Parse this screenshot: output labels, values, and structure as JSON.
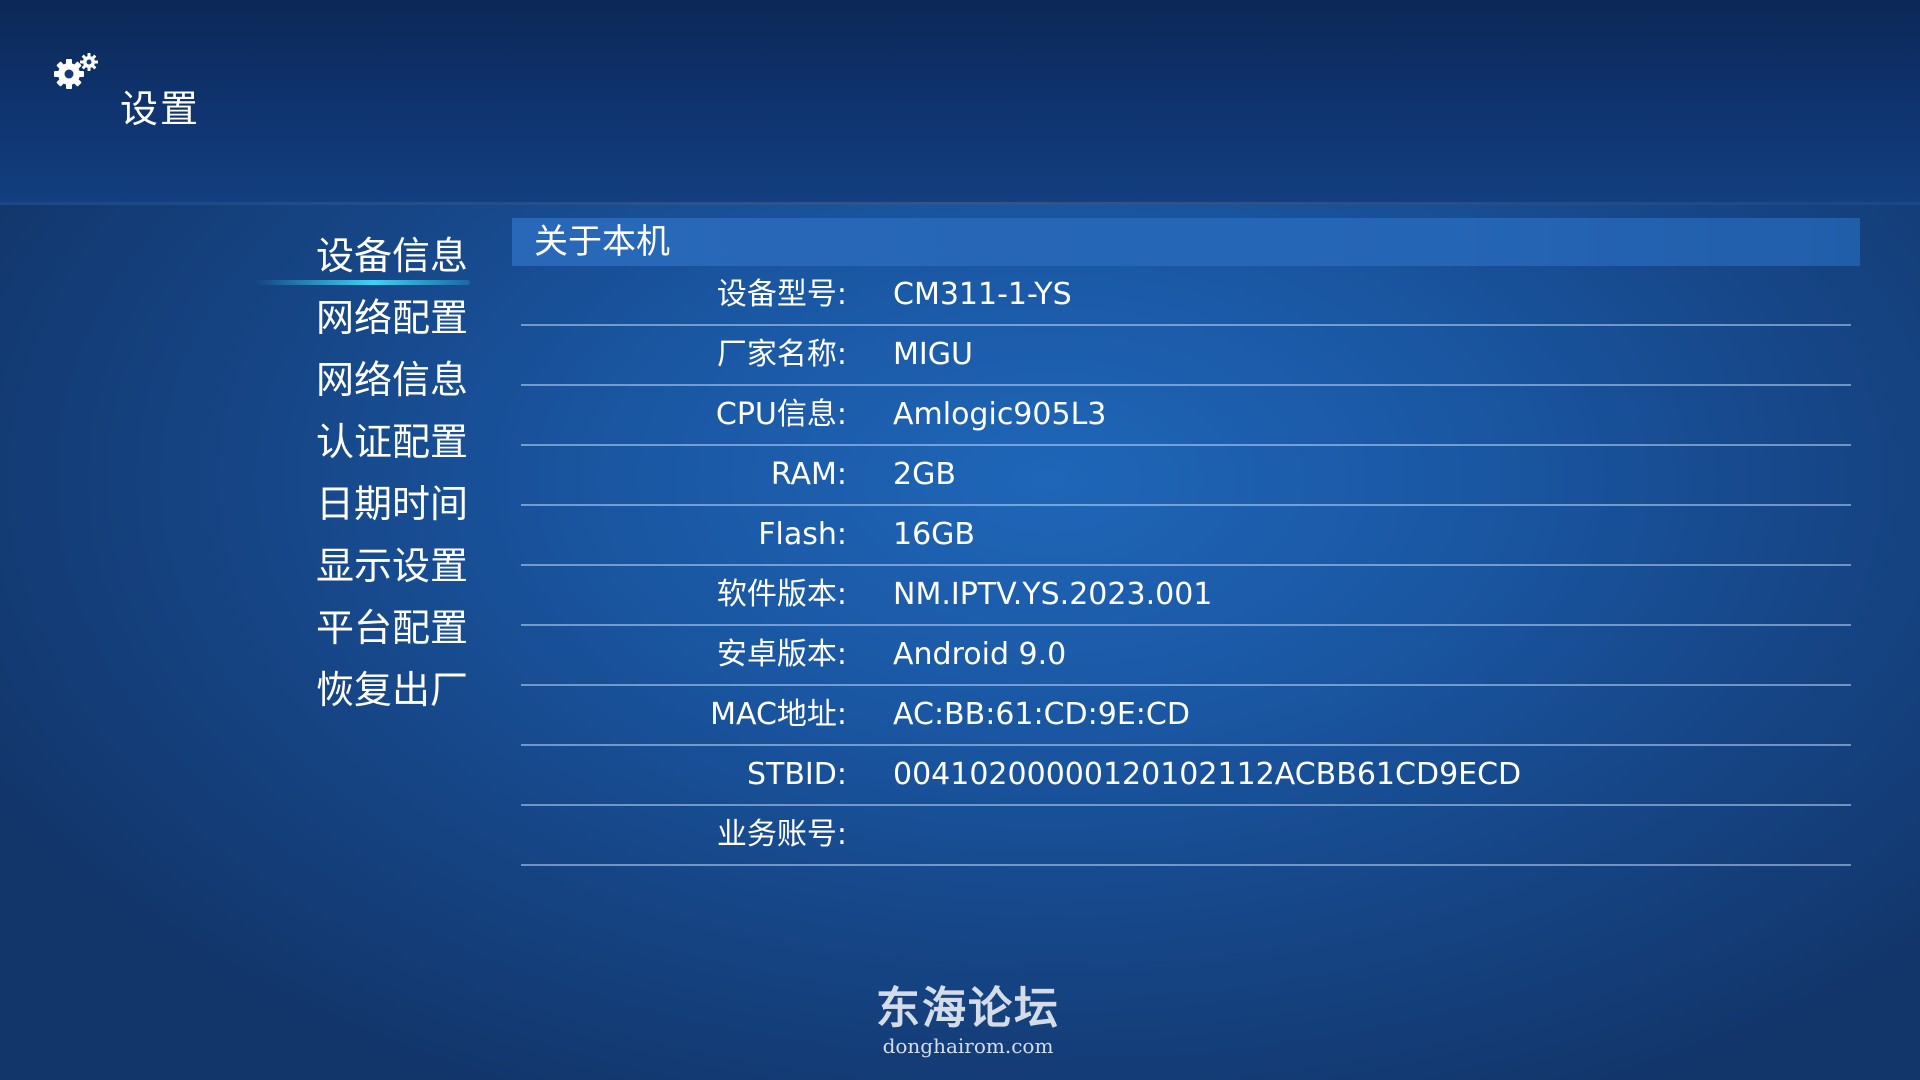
{
  "header": {
    "title": "设置",
    "icon": "gear-icon"
  },
  "menu": {
    "items": [
      {
        "label": "设备信息",
        "active": true
      },
      {
        "label": "网络配置"
      },
      {
        "label": "网络信息"
      },
      {
        "label": "认证配置"
      },
      {
        "label": "日期时间"
      },
      {
        "label": "显示设置"
      },
      {
        "label": "平台配置"
      },
      {
        "label": "恢复出厂"
      }
    ]
  },
  "panel": {
    "title": "关于本机",
    "rows": [
      {
        "label": "设备型号:",
        "value": "CM311-1-YS"
      },
      {
        "label": "厂家名称:",
        "value": "MIGU"
      },
      {
        "label": "CPU信息:",
        "value": "Amlogic905L3"
      },
      {
        "label": "RAM:",
        "value": "2GB"
      },
      {
        "label": "Flash:",
        "value": "16GB"
      },
      {
        "label": "软件版本:",
        "value": "NM.IPTV.YS.2023.001"
      },
      {
        "label": "安卓版本:",
        "value": "Android 9.0"
      },
      {
        "label": "MAC地址:",
        "value": "AC:BB:61:CD:9E:CD"
      },
      {
        "label": "STBID:",
        "value": "00410200000120102112ACBB61CD9ECD"
      },
      {
        "label": "业务账号:",
        "value": ""
      }
    ]
  },
  "watermark": {
    "name": "东海论坛",
    "url": "donghairom.com"
  },
  "colors": {
    "accent": "#46e1ff",
    "header_bar": "#2767b7",
    "background": "#1a57a3"
  }
}
